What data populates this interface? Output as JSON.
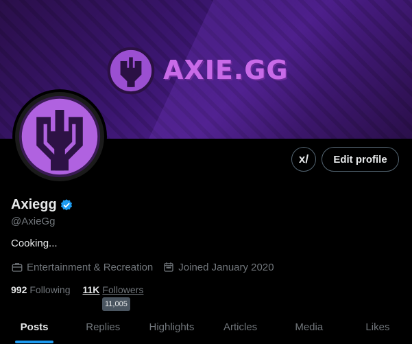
{
  "banner": {
    "title": "AXIE.GG",
    "logo_icon": "axie-gg-logo-icon",
    "colors": {
      "logo": "#b062e0",
      "text": "#c96ae8",
      "bg": "#3b1670"
    }
  },
  "profile": {
    "avatar_icon": "axie-gg-avatar-icon",
    "name": "Axiegg",
    "verified_icon": "verified-badge-icon",
    "handle": "@AxieGg",
    "bio": "Cooking...",
    "category": "Entertainment & Recreation",
    "category_icon": "briefcase-icon",
    "joined": "Joined January 2020",
    "joined_icon": "calendar-icon"
  },
  "actions": {
    "grok_label": "x/",
    "grok_icon": "grok-icon",
    "edit_label": "Edit profile"
  },
  "stats": {
    "following_count": "992",
    "following_label": "Following",
    "followers_count": "11K",
    "followers_label": "Followers",
    "followers_tooltip": "11,005"
  },
  "tabs": [
    {
      "label": "Posts",
      "active": true
    },
    {
      "label": "Replies",
      "active": false
    },
    {
      "label": "Highlights",
      "active": false
    },
    {
      "label": "Articles",
      "active": false
    },
    {
      "label": "Media",
      "active": false
    },
    {
      "label": "Likes",
      "active": false
    }
  ],
  "colors": {
    "accent": "#1d9bf0",
    "muted": "#71767b",
    "text": "#e7e9ea",
    "background": "#000000"
  }
}
